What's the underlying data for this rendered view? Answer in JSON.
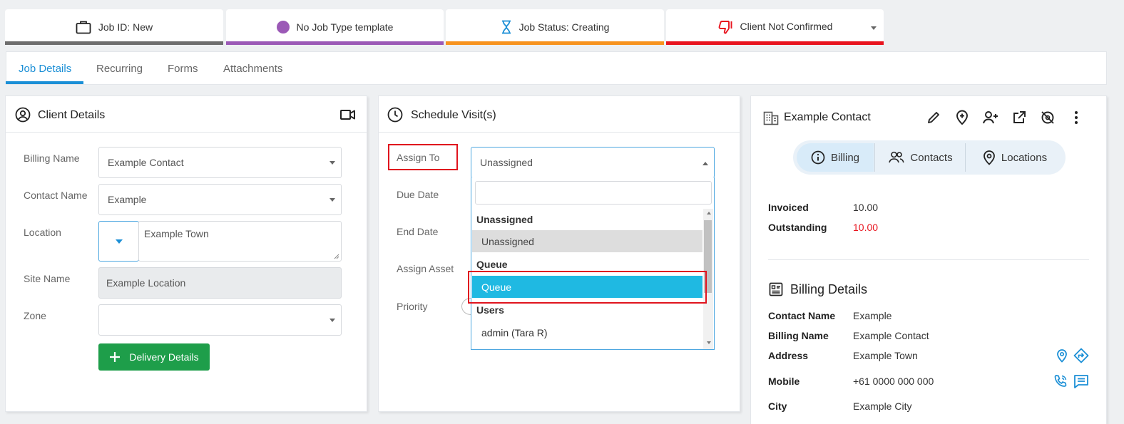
{
  "status_bar": {
    "job_id": "Job ID: New",
    "job_type": "No Job Type template",
    "job_status": "Job Status: Creating",
    "client_confirm": "Client Not Confirmed",
    "colors": {
      "job_id": "#6d6d6d",
      "job_type": "#9b59b6",
      "job_status": "#f7931e",
      "client_confirm": "#e8141e"
    }
  },
  "tabs": {
    "job_details": "Job Details",
    "recurring": "Recurring",
    "forms": "Forms",
    "attachments": "Attachments"
  },
  "client_details": {
    "title": "Client Details",
    "billing_name_label": "Billing Name",
    "billing_name_value": "Example Contact",
    "contact_name_label": "Contact Name",
    "contact_name_value": "Example",
    "location_label": "Location",
    "location_value": "Example Town",
    "site_name_label": "Site Name",
    "site_name_value": "Example Location",
    "zone_label": "Zone",
    "zone_value": "",
    "delivery_button": "Delivery Details"
  },
  "schedule": {
    "title": "Schedule Visit(s)",
    "assign_to_label": "Assign To",
    "assign_to_value": "Unassigned",
    "due_date_label": "Due Date",
    "end_date_label": "End Date",
    "assign_asset_label": "Assign Asset",
    "priority_label": "Priority",
    "dropdown": {
      "search_value": "",
      "group_unassigned": "Unassigned",
      "opt_unassigned": "Unassigned",
      "group_queue": "Queue",
      "opt_queue": "Queue",
      "group_users": "Users",
      "opt_admin": "admin (Tara R)"
    }
  },
  "contact_panel": {
    "title": "Example Contact",
    "seg_billing": "Billing",
    "seg_contacts": "Contacts",
    "seg_locations": "Locations",
    "invoiced_label": "Invoiced",
    "invoiced_value": "10.00",
    "outstanding_label": "Outstanding",
    "outstanding_value": "10.00",
    "billing_details_title": "Billing Details",
    "contact_name_label": "Contact Name",
    "contact_name_value": "Example",
    "billing_name_label": "Billing Name",
    "billing_name_value": "Example Contact",
    "address_label": "Address",
    "address_value": "Example Town",
    "mobile_label": "Mobile",
    "mobile_value": "+61 0000 000 000",
    "city_label": "City",
    "city_value": "Example City"
  },
  "colors": {
    "accent": "#1b8fd6",
    "highlight": "#1fb9e2",
    "alert": "#e8141e",
    "success": "#1e9e4a"
  }
}
